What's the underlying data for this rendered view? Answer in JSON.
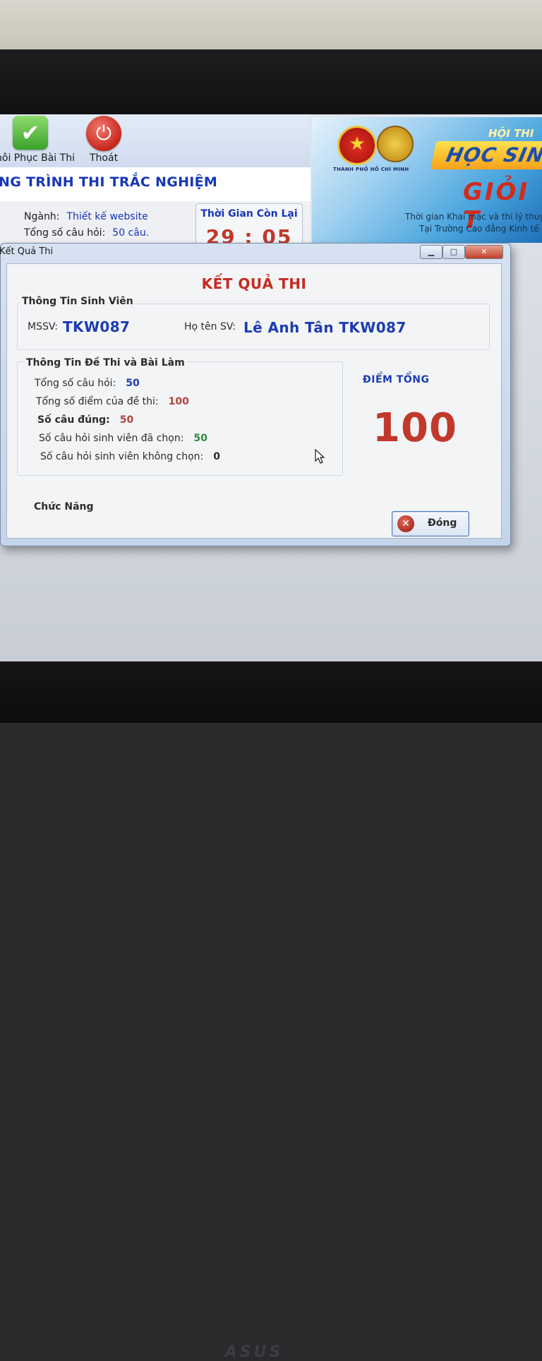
{
  "toolbar": {
    "restore_label": "hôi Phục Bài Thi",
    "exit_label": "Thoát"
  },
  "app": {
    "title": "NG TRÌNH THI TRẮC NGHIỆM",
    "major_key": "Ngành:",
    "major_value": "Thiết kế website",
    "questions_key": "Tổng số câu hỏi:",
    "questions_value": "50 câu.",
    "timer_label": "Thời Gian Còn Lại",
    "timer_value": "29 : 05"
  },
  "banner": {
    "caption": "THÀNH PHỐ HỒ CHÍ MINH",
    "hoithi": "HỘI THI",
    "hocsinh": "HỌC SINH",
    "gioi": "GIỎI T",
    "line1": "Thời gian Khai mạc và thi lý thuy",
    "line2": "Tại Trường Cao đẳng Kinh tế -"
  },
  "dialog": {
    "caption": "Kết Quả Thi",
    "heading": "KẾT QUẢ THI",
    "student_group_title": "Thông Tin Sinh Viên",
    "mssv_key": "MSSV:",
    "mssv_value": "TKW087",
    "name_key": "Họ tên SV:",
    "name_value": "Lê Anh Tân TKW087",
    "exam_group_title": "Thông Tin Đề Thi và Bài Làm",
    "rows": [
      {
        "key": "Tổng số câu hỏi:",
        "value": "50"
      },
      {
        "key": "Tổng số điểm của đề thi:",
        "value": "100"
      },
      {
        "key": "Số câu đúng:",
        "value": "50"
      },
      {
        "key": "Số câu hỏi sinh viên đã chọn:",
        "value": "50"
      },
      {
        "key": "Số câu hỏi sinh viên không chọn:",
        "value": "0"
      }
    ],
    "total_label": "ĐIỂM TỔNG",
    "total_value": "100",
    "function_label": "Chức Năng",
    "close_label": "Đóng"
  },
  "monitor_brand": "ASUS",
  "colors": {
    "accent_blue": "#1c3db0",
    "accent_red": "#c0392b",
    "value_green": "#2e8b3d"
  }
}
